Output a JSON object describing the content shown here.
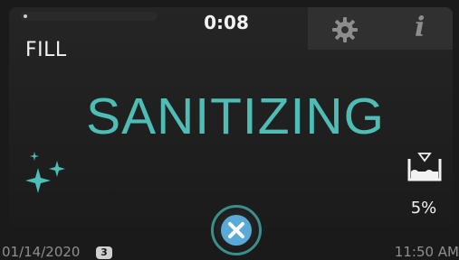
{
  "status": {
    "timer": "0:08",
    "mode": "FILL",
    "cycle_title": "SANITIZING",
    "progress_fraction": 0.02
  },
  "water_level": {
    "percent": "5%",
    "icon": "water-level-icon"
  },
  "toolbar": {
    "settings_icon": "gear-icon",
    "info_icon": "info-icon",
    "info_glyph": "i"
  },
  "footer": {
    "date": "01/14/2020",
    "badge": "3",
    "time": "11:50 AM"
  },
  "controls": {
    "cancel_icon": "close-icon"
  },
  "colors": {
    "accent": "#4dbdb6",
    "text": "#f2f2f2",
    "muted": "#8f8f8f"
  }
}
